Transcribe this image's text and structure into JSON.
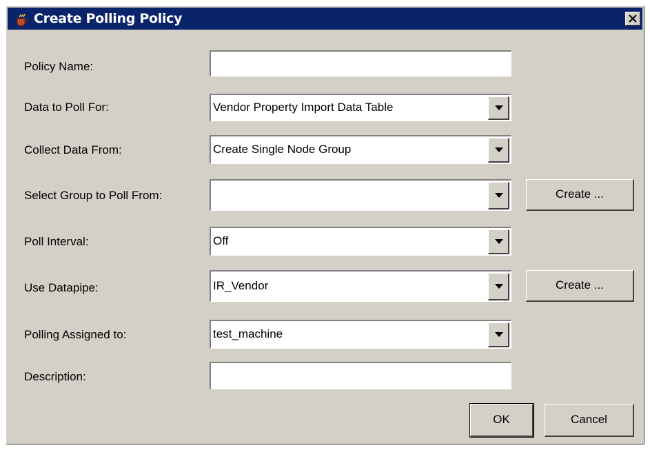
{
  "dialog": {
    "title": "Create Polling Policy",
    "app_icon": "coffee-cup-icon",
    "close_icon": "close-icon"
  },
  "form": {
    "policy_name": {
      "label": "Policy Name:",
      "value": ""
    },
    "data_to_poll": {
      "label": "Data to Poll For:",
      "value": "Vendor Property Import Data Table"
    },
    "collect_data_from": {
      "label": "Collect Data From:",
      "value": "Create Single Node Group"
    },
    "select_group": {
      "label": "Select Group to Poll From:",
      "value": "",
      "create_label": "Create ..."
    },
    "poll_interval": {
      "label": "Poll Interval:",
      "value": "Off"
    },
    "use_datapipe": {
      "label": "Use Datapipe:",
      "value": "IR_Vendor",
      "create_label": "Create ..."
    },
    "polling_assigned": {
      "label": "Polling Assigned to:",
      "value": "test_machine"
    },
    "description": {
      "label": "Description:",
      "value": ""
    }
  },
  "buttons": {
    "ok": "OK",
    "cancel": "Cancel"
  },
  "colors": {
    "titlebar": "#0a246a",
    "dialog_bg": "#d4d0c8"
  }
}
